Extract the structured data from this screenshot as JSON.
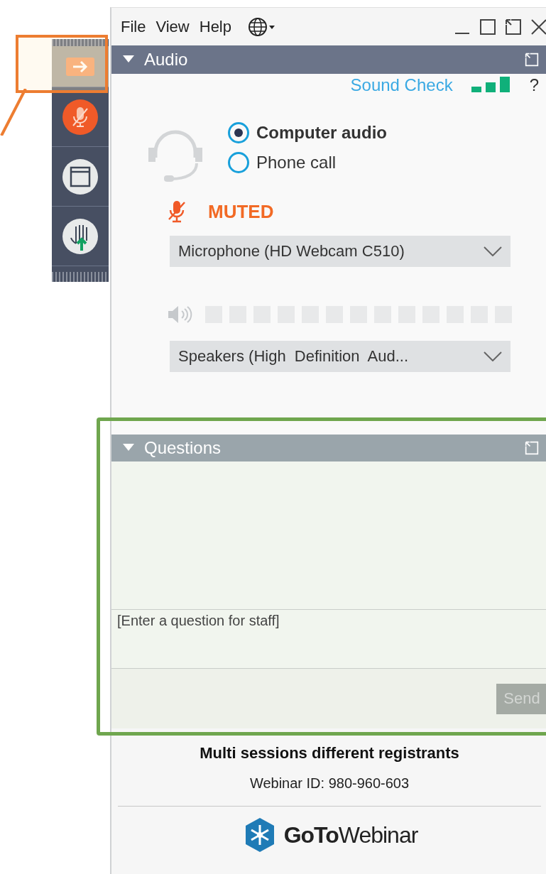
{
  "control_strip": {
    "highlighted": true,
    "buttons": [
      {
        "kind": "arrow"
      },
      {
        "kind": "mic-muted"
      },
      {
        "kind": "window"
      },
      {
        "kind": "hand"
      }
    ]
  },
  "menu": [
    "File",
    "View",
    "Help"
  ],
  "audio": {
    "title": "Audio",
    "sound_check": "Sound Check",
    "help": "?",
    "options": [
      {
        "label": "Computer audio",
        "selected": true
      },
      {
        "label": "Phone call",
        "selected": false
      }
    ],
    "muted": true,
    "mute_label": "MUTED",
    "microphone": "Microphone (HD Webcam C510)",
    "speaker_level": {
      "level": 0
    },
    "speakers": "Speakers (High  Definition  Aud..."
  },
  "questions": {
    "highlighted": true,
    "title": "Questions",
    "placeholder": "[Enter a question for staff]",
    "send": {
      "label": "Send",
      "disabled": true
    }
  },
  "footer": {
    "title": "Multi sessions different registrants",
    "webinar_id": "Webinar ID: 980-960-603",
    "brand": "**GoTo**Webinar"
  }
}
